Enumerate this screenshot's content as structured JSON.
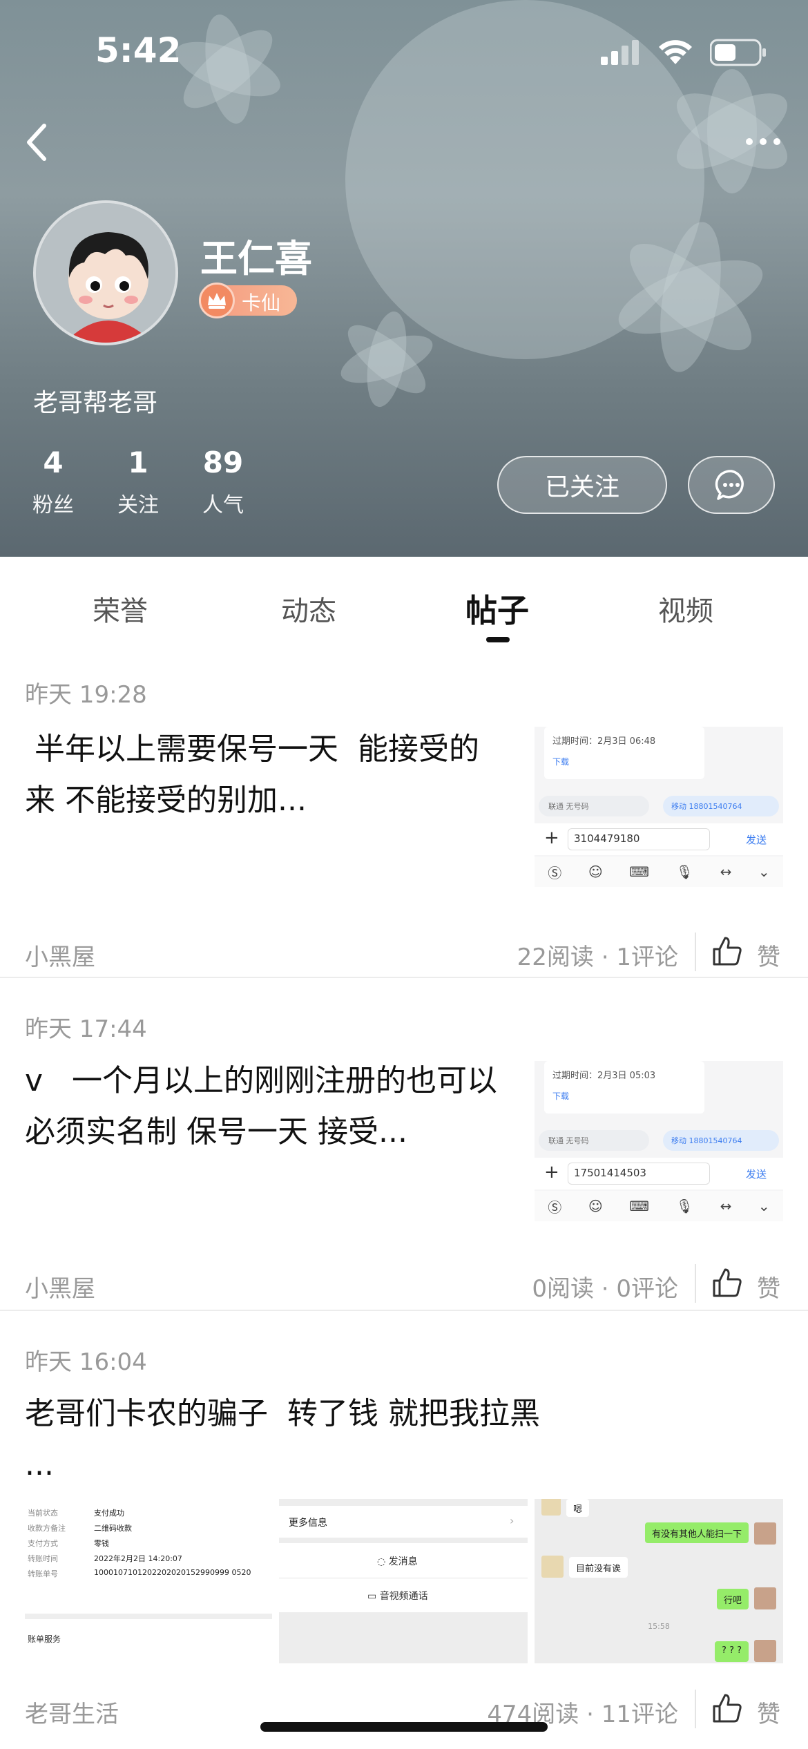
{
  "status_bar": {
    "time": "5:42"
  },
  "profile": {
    "name": "王仁喜",
    "badge": "卡仙",
    "bio": "老哥帮老哥",
    "stats": [
      {
        "value": "4",
        "label": "粉丝"
      },
      {
        "value": "1",
        "label": "关注"
      },
      {
        "value": "89",
        "label": "人气"
      }
    ],
    "follow_label": "已关注"
  },
  "tabs": [
    {
      "label": "荣誉",
      "active": false
    },
    {
      "label": "动态",
      "active": false
    },
    {
      "label": "帖子",
      "active": true
    },
    {
      "label": "视频",
      "active": false
    }
  ],
  "posts": [
    {
      "time": "昨天 19:28",
      "text": " 半年以上需要保号一天  能接受的来 不能接受的别加...",
      "source": "小黑屋",
      "stats": "22阅读 · 1评论",
      "like_label": "赞",
      "thumb": {
        "expire": "过期时间：2月3日 06:48",
        "download": "下载",
        "left_pill": "联通  无号码",
        "right_pill": "移动  18801540764",
        "input": "3104479180",
        "send": "发送"
      }
    },
    {
      "time": "昨天 17:44",
      "text": "v   一个月以上的刚刚注册的也可以必须实名制 保号一天 接受...",
      "source": "小黑屋",
      "stats": "0阅读 · 0评论",
      "like_label": "赞",
      "thumb": {
        "expire": "过期时间：2月3日 05:03",
        "download": "下载",
        "left_pill": "联通  无号码",
        "right_pill": "移动  18801540764",
        "input": "17501414503",
        "send": "发送"
      }
    },
    {
      "time": "昨天 16:04",
      "text": "老哥们卡农的骗子  转了钱 就把我拉黑\n...",
      "source": "老哥生活",
      "stats": "474阅读 · 11评论",
      "like_label": "赞",
      "images": {
        "payment": [
          {
            "k": "当前状态",
            "v": "支付成功"
          },
          {
            "k": "收款方备注",
            "v": "二维码收款"
          },
          {
            "k": "支付方式",
            "v": "零钱"
          },
          {
            "k": "转账时间",
            "v": "2022年2月2日 14:20:07"
          },
          {
            "k": "转账单号",
            "v": "1000107101202202020152990999 0520"
          }
        ],
        "bill_service": "账单服务",
        "more_info": "更多信息",
        "send_msg": "发消息",
        "av_call": "音视频通话",
        "chat": [
          {
            "side": "left",
            "text": "嗯"
          },
          {
            "side": "right",
            "text": "有没有其他人能扫一下"
          },
          {
            "side": "left",
            "text": "目前没有诶"
          },
          {
            "side": "right",
            "text": "行吧"
          },
          {
            "side": "time",
            "text": "15:58"
          },
          {
            "side": "right",
            "text": "? ? ?"
          }
        ]
      }
    }
  ]
}
